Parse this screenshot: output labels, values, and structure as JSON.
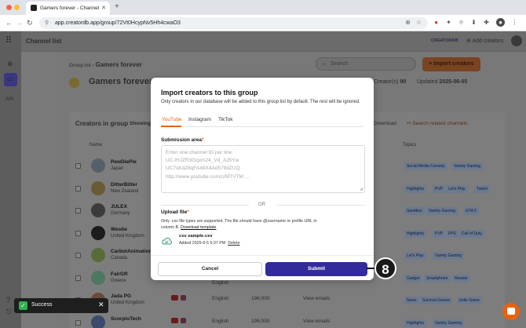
{
  "browser": {
    "tab_title": "Gamers forever - Channel list",
    "url": "app.creatordb.app/group/72Vt0HcypNv5Hh4cwaO3"
  },
  "app": {
    "topbar_title": "Channel list",
    "brand_badge": "CREATORDB",
    "add_creators": "Add creators",
    "nav_api": "API",
    "breadcrumb_root": "Group list",
    "breadcrumb_current": "Gamers forever",
    "search_placeholder": "Search",
    "import_button": "+ Import creators",
    "group_title": "Gamers forever",
    "creators_label": "Creator(s)",
    "creators_count": "90",
    "updated_label": "Updated",
    "updated_value": "2025-06-05",
    "panel_title": "Creators in group",
    "showing_label": "Showing",
    "download_label": "Download",
    "search_related": "Search related channels",
    "col_name": "Name",
    "col_topics": "Topics"
  },
  "rows": [
    {
      "name": "PewDiePie",
      "country": "Japan",
      "avatar": "#55606a",
      "tags": [
        "Social Media Comedy",
        "Variety Gaming"
      ]
    },
    {
      "name": "DitterBitter",
      "country": "New Zealand",
      "avatar": "#6b5a36",
      "tags": [
        "Highlights",
        "PVP",
        "Let's Play",
        "Twitch"
      ]
    },
    {
      "name": "JULEX",
      "country": "Germany",
      "avatar": "#3b3b3b",
      "tags": [
        "Sandbox",
        "Variety Gaming",
        "GTA 5"
      ]
    },
    {
      "name": "Westie",
      "country": "United Kingdom",
      "avatar": "#1c1c1c",
      "tags": [
        "Highlights",
        "PVP",
        "FPS",
        "Call of Duty"
      ]
    },
    {
      "name": "CarbotAnimations",
      "country": "Canada",
      "avatar": "#5a6b3a",
      "tags": [
        "Let's Play",
        "Variety Gaming"
      ]
    },
    {
      "name": "FairGR",
      "country": "Greece",
      "avatar": "#4d7760",
      "tags": [
        "Gadget",
        "Smartphone",
        "Review"
      ]
    },
    {
      "name": "Jada PG",
      "country": "United Kingdom",
      "avatar": "#6b4a3a",
      "language": "English",
      "subs": "196,000",
      "view_emails": "View emails",
      "tags": [
        "News",
        "Survival Games",
        "Indie Game"
      ]
    },
    {
      "name": "ScorpioTech",
      "country": "",
      "avatar": "#3a4a6b",
      "language": "English",
      "subs": "196,000",
      "view_emails": "View emails",
      "tags": [
        "Highlights",
        "Variety Gaming"
      ]
    }
  ],
  "row5_language": "English",
  "modal": {
    "title": "Import creators to this group",
    "description": "Only creators in our database will be added to this group list by default. The rest will be ignored.",
    "tabs": [
      "YouTube",
      "Instagram",
      "TikTok"
    ],
    "submission_label": "Submission area",
    "required_mark": "*",
    "textarea_placeholder": "Enter one channel ID per line:\nUC-lHJZR3Gqxm24_Vd_AJ5Yw\nUC7sKdZ8qFA48X4Ad579dZUQ\nhttp://www.youtube.com/c/MTVTM ...",
    "or_text": "OR",
    "upload_label": "Upload file",
    "upload_desc": "Only .csv file types are supported. The file should have @username or profile URL in column B.",
    "download_template": "Download template",
    "file_name": "csv sample.csv",
    "file_meta": "Added 2025-6-5 5:37 PM",
    "file_delete": "Delete",
    "cancel": "Cancel",
    "submit": "Submit"
  },
  "step_badge": "8",
  "toast": {
    "text": "Success"
  },
  "colors": {
    "accent_orange": "#e8630f",
    "submit_purple": "#332b9b",
    "success_green": "#2eb24f"
  }
}
